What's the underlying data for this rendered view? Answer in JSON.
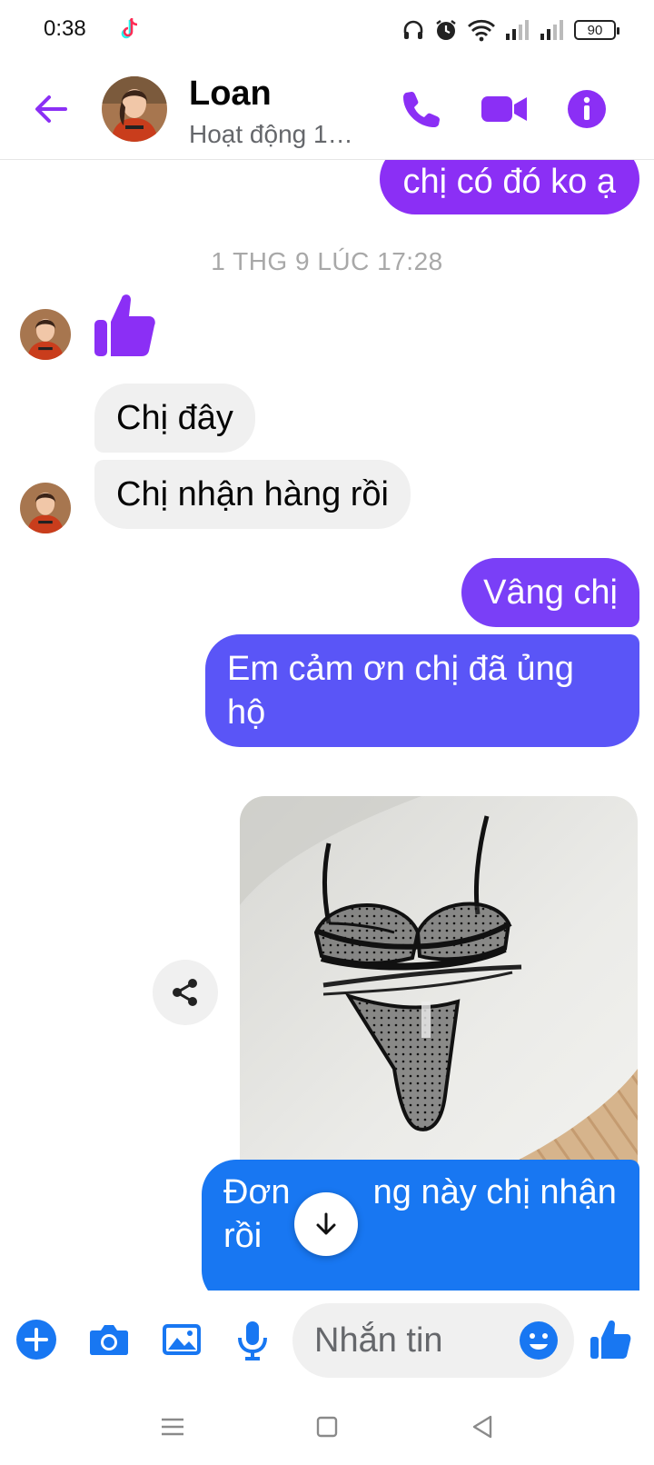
{
  "status_bar": {
    "time": "0:38",
    "battery": "90",
    "icons": [
      "tiktok-icon",
      "headphones-icon",
      "alarm-icon",
      "wifi-icon",
      "signal-icon",
      "signal-icon",
      "battery-icon"
    ]
  },
  "header": {
    "contact_name": "Loan",
    "status": "Hoạt động 1…",
    "accent_color": "#8b2ff5"
  },
  "chat": {
    "messages": [
      {
        "direction": "out",
        "text": "chị có đó ko ạ",
        "color": "#8b2ff5"
      },
      {
        "type": "timestamp",
        "text": "1 THG 9 LÚC 17:28"
      },
      {
        "direction": "in",
        "type": "like-sticker"
      },
      {
        "direction": "in",
        "text": "Chị đây"
      },
      {
        "direction": "in",
        "text": "Chị nhận hàng rồi"
      },
      {
        "direction": "out",
        "text": "Vâng chị",
        "color": "#7a3ff7"
      },
      {
        "direction": "out",
        "text": "Em cảm ơn chị đã ủng hộ",
        "color": "#5a55f7"
      },
      {
        "direction": "out",
        "type": "photo"
      },
      {
        "direction": "out",
        "text": "Đơn hàng này chị nhận rồi",
        "visible_text": [
          "Đơn",
          "ng này chị nhận",
          "rồi"
        ],
        "color": "#1877f2"
      }
    ]
  },
  "composer": {
    "placeholder": "Nhắn tin",
    "icons": [
      "plus-icon",
      "camera-icon",
      "gallery-icon",
      "microphone-icon",
      "emoji-icon",
      "like-icon"
    ]
  },
  "colors": {
    "purple": "#8b2ff5",
    "indigo": "#5a55f7",
    "blue": "#1877f2",
    "incoming_bg": "#f0f0f0"
  }
}
